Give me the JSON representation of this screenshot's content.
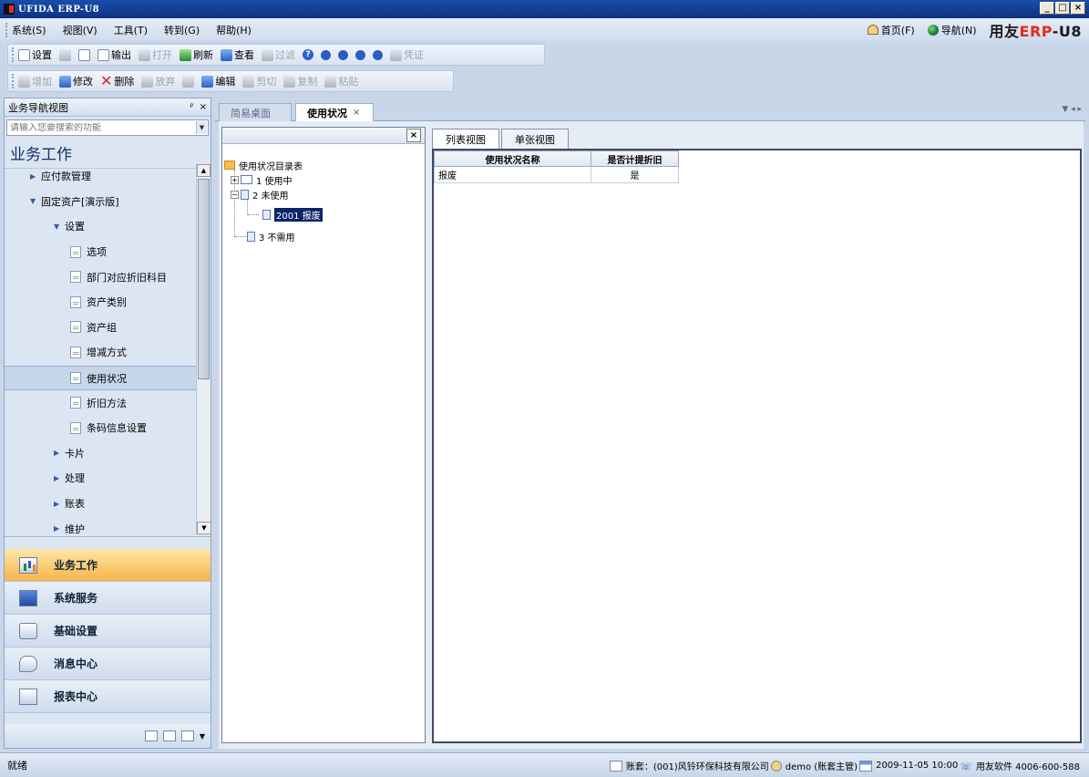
{
  "window": {
    "title": "UFIDA ERP-U8",
    "min": "_",
    "max": "□",
    "close": "×"
  },
  "menu": {
    "items": [
      "系统(S)",
      "视图(V)",
      "工具(T)",
      "转到(G)",
      "帮助(H)"
    ]
  },
  "quick_links": {
    "home": "首页(F)",
    "nav": "导航(N)"
  },
  "brand": {
    "prefix": "用友",
    "red": "ERP",
    "suffix": "-U8"
  },
  "toolbar1": {
    "setup": "设置",
    "output": "输出",
    "open": "打开",
    "refresh": "刷新",
    "view": "查看",
    "filter": "过滤",
    "voucher": "凭证"
  },
  "toolbar2": {
    "add": "增加",
    "modify": "修改",
    "delete": "删除",
    "discard": "放弃",
    "edit": "编辑",
    "cut": "剪切",
    "copy": "复制",
    "paste": "粘贴"
  },
  "left_panel": {
    "header": "业务导航视图",
    "pin": "ᵖ",
    "close": "×",
    "search_placeholder": "请输入您要搜索的功能",
    "section_title": "业务工作",
    "tree": [
      {
        "label": "应付款管理",
        "level": 1,
        "expanded": false
      },
      {
        "label": "固定资产[演示版]",
        "level": 1,
        "expanded": true
      },
      {
        "label": "设置",
        "level": 2,
        "expanded": true
      },
      {
        "label": "选项",
        "level": 3
      },
      {
        "label": "部门对应折旧科目",
        "level": 3
      },
      {
        "label": "资产类别",
        "level": 3
      },
      {
        "label": "资产组",
        "level": 3
      },
      {
        "label": "增减方式",
        "level": 3
      },
      {
        "label": "使用状况",
        "level": 3,
        "selected": true
      },
      {
        "label": "折旧方法",
        "level": 3
      },
      {
        "label": "条码信息设置",
        "level": 3
      },
      {
        "label": "卡片",
        "level": 2,
        "expanded": false
      },
      {
        "label": "处理",
        "level": 2,
        "expanded": false
      },
      {
        "label": "账表",
        "level": 2,
        "expanded": false
      },
      {
        "label": "维护",
        "level": 2,
        "expanded": false
      }
    ],
    "big_nav": [
      "业务工作",
      "系统服务",
      "基础设置",
      "消息中心",
      "报表中心"
    ]
  },
  "tabs": [
    {
      "label": "简易桌面"
    },
    {
      "label": "使用状况",
      "close": "×",
      "active": true
    }
  ],
  "tree_pane": {
    "close": "×",
    "root": "使用状况目录表",
    "nodes": [
      "1 使用中",
      "2 未使用",
      "2001 报废",
      "3 不需用"
    ]
  },
  "view_tabs": [
    "列表视图",
    "单张视图"
  ],
  "grid": {
    "columns": [
      "使用状况名称",
      "是否计提折旧"
    ],
    "rows": [
      [
        "报废",
        "是"
      ]
    ]
  },
  "status": {
    "left": "就绪",
    "account": "账套：(001)风铃环保科技有限公司",
    "user": "demo (账套主管)",
    "datetime": "2009-11-05 10:00",
    "vendor": "用友软件 4006-600-588"
  }
}
